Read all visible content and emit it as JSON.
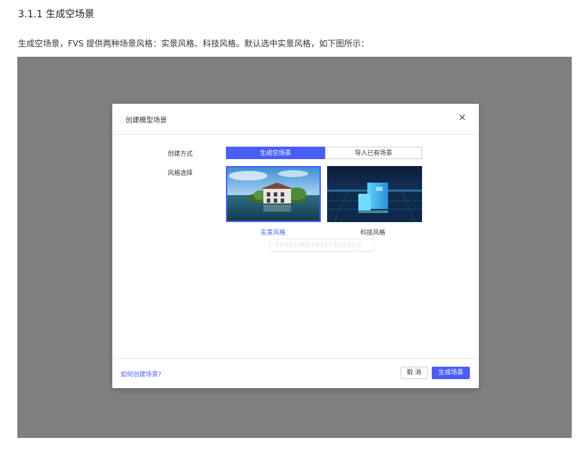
{
  "doc": {
    "heading": "3.1.1 生成空场景",
    "paragraph": "生成空场景，FVS 提供两种场景风格：实景风格、科技风格。默认选中实景风格，如下图所示："
  },
  "dialog": {
    "title": "创建模型场景",
    "close_icon": "×",
    "method_label": "创建方式",
    "method_options": [
      "生成空场景",
      "导入已有场景"
    ],
    "style_label": "风格选择",
    "styles": [
      {
        "caption": "实景风格",
        "selected": true
      },
      {
        "caption": "科技风格",
        "selected": false
      }
    ],
    "watermark": "1695196838317508.png",
    "help_link": "如何创建场景?",
    "cancel_label": "取 消",
    "generate_label": "生成场景"
  },
  "colors": {
    "accent": "#4a5df5",
    "backdrop": "#7f7f7f"
  }
}
